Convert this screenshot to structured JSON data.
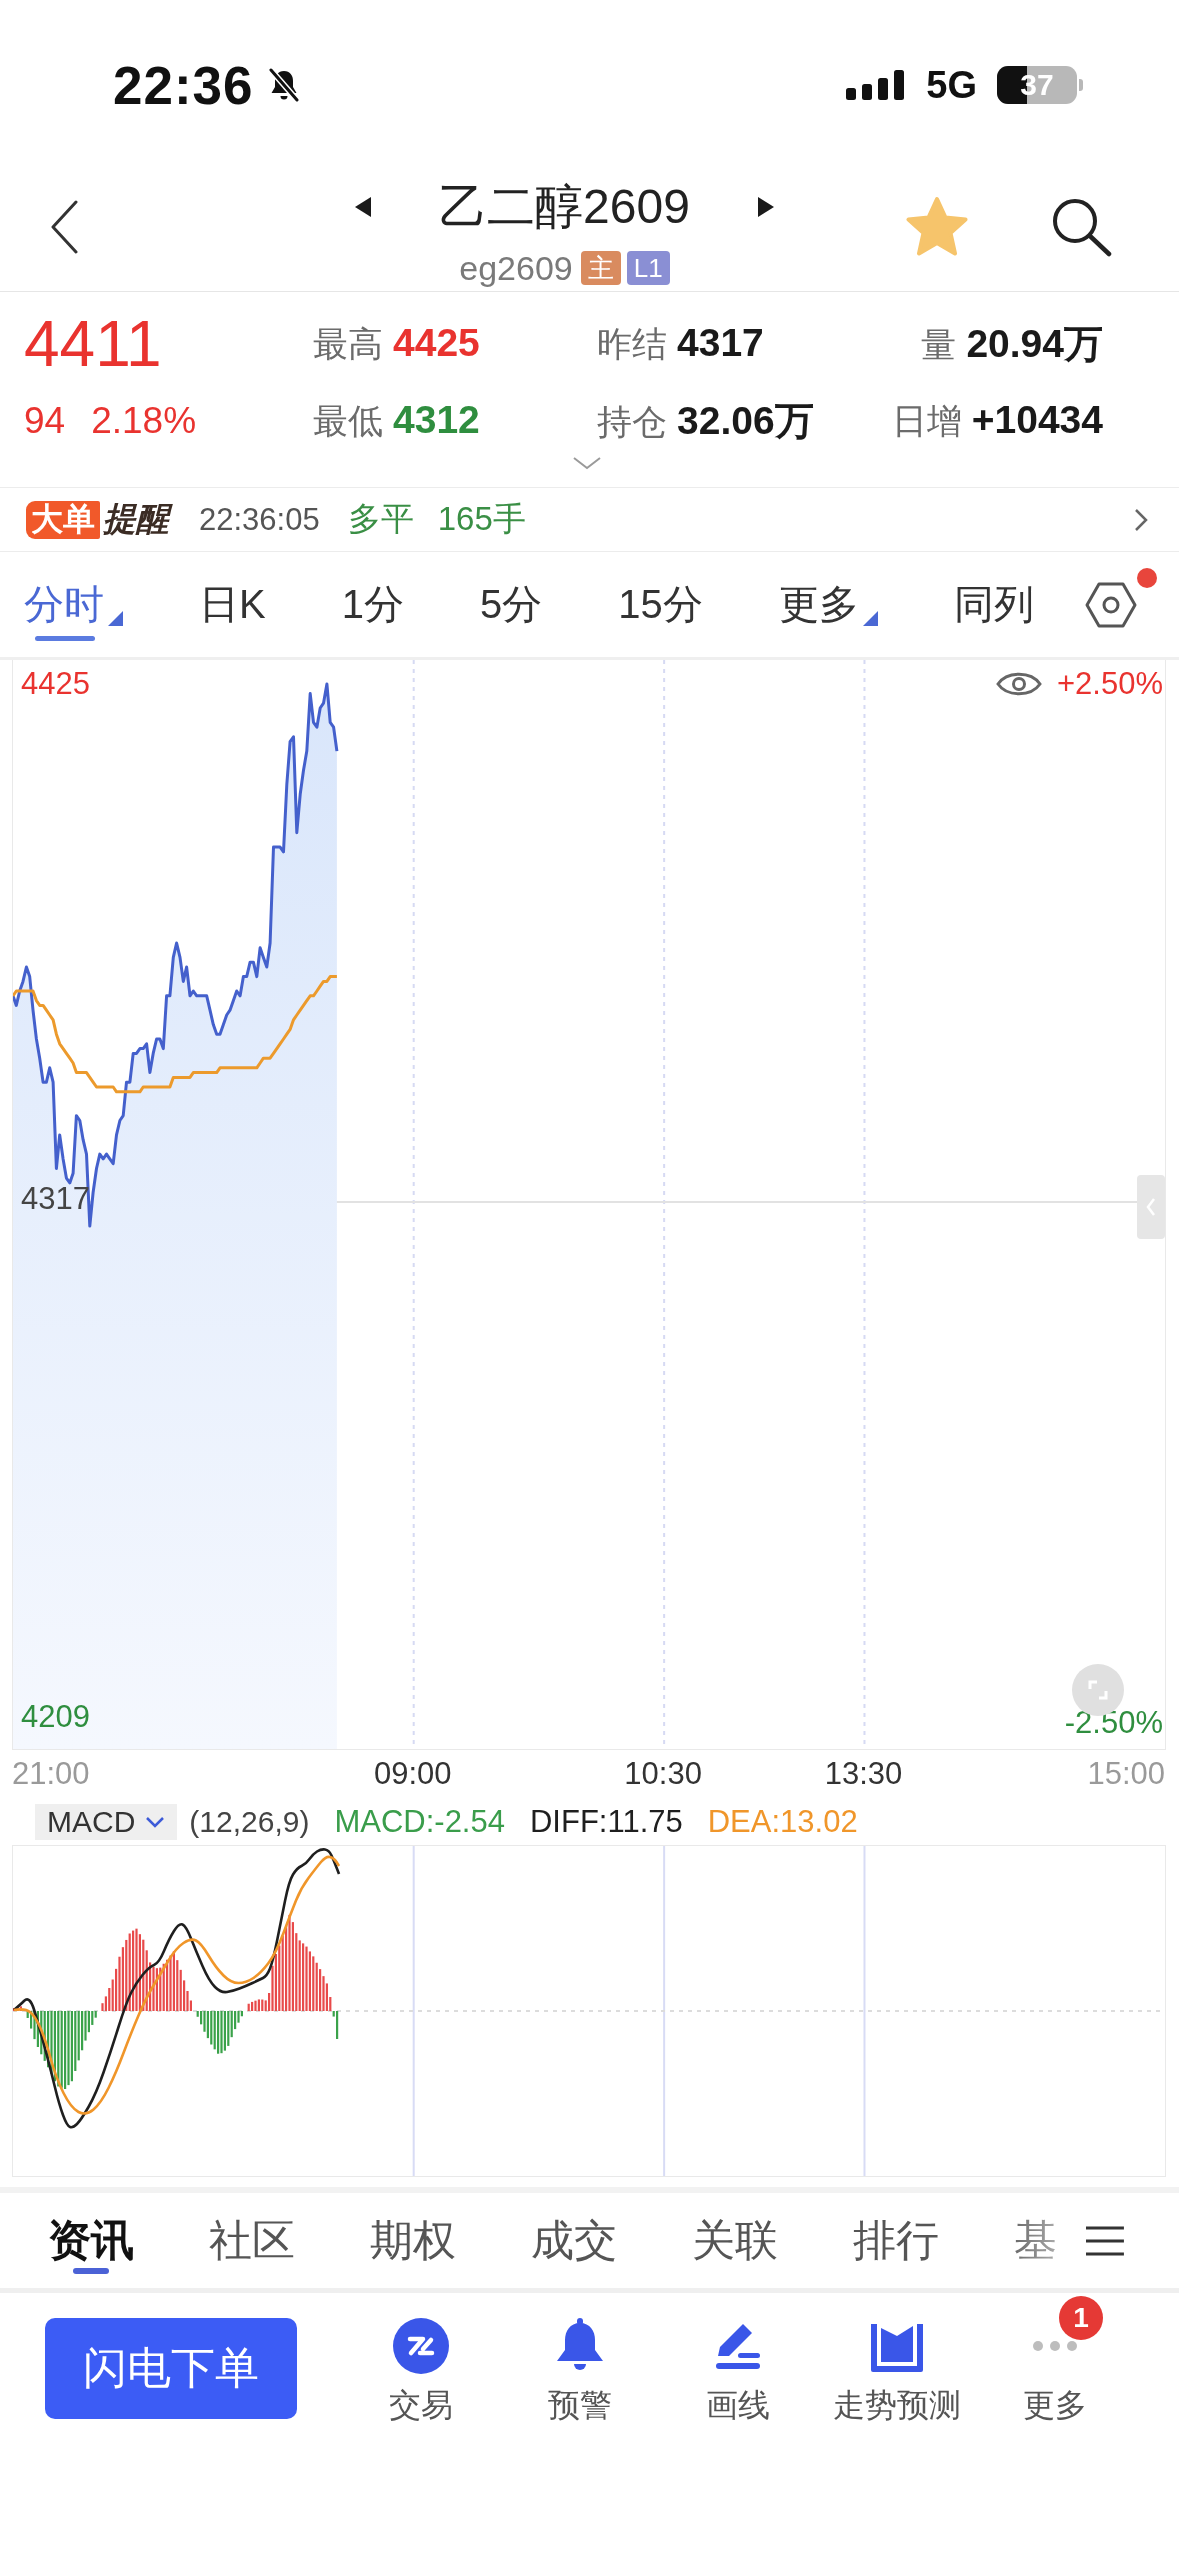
{
  "status_bar": {
    "time": "22:36",
    "silent": true,
    "network": "5G",
    "battery": "37"
  },
  "header": {
    "title": "乙二醇2609",
    "code": "eg2609",
    "badges": [
      {
        "text": "主",
        "kind": "main"
      },
      {
        "text": "L1",
        "kind": "level"
      }
    ],
    "favorite": true
  },
  "quote": {
    "price": "4411",
    "change": "94",
    "change_percent": "2.18%",
    "rising": true,
    "stats": [
      {
        "label": "最高",
        "value": "4425",
        "color": "#e9332f"
      },
      {
        "label": "昨结",
        "value": "4317",
        "color": "#1a1a1a"
      },
      {
        "label": "量",
        "value": "20.94万",
        "color": "#1a1a1a"
      },
      {
        "label": "最低",
        "value": "4312",
        "color": "#2f8e3f"
      },
      {
        "label": "持仓",
        "value": "32.06万",
        "color": "#1a1a1a"
      },
      {
        "label": "日增",
        "value": "+10434",
        "color": "#1a1a1a"
      }
    ]
  },
  "big_order_alert": {
    "badge": "大单",
    "title": "提醒",
    "time": "22:36:05",
    "action": "多平",
    "volume": "165手"
  },
  "period_bar": {
    "tabs": [
      {
        "label": "分时",
        "selected": true,
        "menu": true
      },
      {
        "label": "日K",
        "selected": false,
        "menu": false
      },
      {
        "label": "1分",
        "selected": false,
        "menu": false
      },
      {
        "label": "5分",
        "selected": false,
        "menu": false
      },
      {
        "label": "15分",
        "selected": false,
        "menu": false
      },
      {
        "label": "更多",
        "selected": false,
        "menu": true
      },
      {
        "label": "同列",
        "selected": false,
        "menu": false
      }
    ],
    "settings_dot": true
  },
  "intraday": {
    "chart_data": {
      "type": "line",
      "categories": [
        null,
        null,
        null,
        null,
        null,
        null,
        null,
        null,
        null,
        null,
        null,
        null,
        null,
        null,
        null,
        null,
        null,
        null,
        null,
        null,
        null,
        null,
        null,
        null,
        null,
        null,
        null,
        null,
        null,
        null,
        null,
        null,
        null,
        null,
        null,
        null,
        null,
        null,
        null,
        null,
        null,
        null,
        null,
        null,
        null,
        null,
        null,
        null,
        null,
        null,
        null,
        null,
        null,
        null,
        null,
        null,
        null,
        null,
        null,
        null,
        null,
        null,
        null,
        null,
        null,
        null,
        null,
        null,
        null,
        null,
        null,
        null,
        null,
        null,
        null,
        null,
        null,
        null,
        null,
        null,
        null,
        null,
        null,
        null,
        null,
        null,
        null,
        null,
        null,
        null,
        null,
        null,
        null,
        null,
        null,
        null,
        null,
        null,
        null,
        null,
        null,
        null,
        null,
        null,
        null,
        null,
        null,
        null,
        null,
        null,
        null,
        null,
        null,
        null,
        null,
        null,
        null,
        null,
        null,
        null,
        "09:00",
        null,
        null,
        null,
        null,
        null,
        null,
        null,
        null,
        null,
        null,
        null,
        null,
        null,
        null,
        null,
        null,
        null,
        null,
        null,
        null,
        null,
        null,
        null,
        null,
        null,
        null,
        null,
        null,
        null,
        null,
        null,
        null,
        null,
        null,
        null,
        null,
        null,
        null,
        null,
        null,
        null,
        null,
        null,
        null,
        null,
        null,
        null,
        null,
        null,
        null,
        null,
        null,
        null,
        null,
        null,
        null,
        null,
        null,
        null,
        null,
        null,
        null,
        null,
        null,
        null,
        null,
        null,
        null,
        null,
        null,
        null,
        null,
        null,
        null,
        "10:30",
        null,
        null,
        null,
        null,
        null,
        null,
        null,
        null,
        null,
        null,
        null,
        null,
        null,
        null,
        null,
        null,
        null,
        null,
        null,
        null,
        null,
        null,
        null,
        null,
        null,
        null,
        null,
        null,
        null,
        null,
        null,
        null,
        null,
        null,
        null,
        null,
        null,
        null,
        null,
        null,
        null,
        null,
        null,
        null,
        null,
        null,
        null,
        null,
        null,
        null,
        null,
        null,
        null,
        null,
        null,
        null,
        null,
        null,
        null,
        "13:30",
        null,
        null,
        null,
        null,
        null,
        null,
        null,
        null,
        null,
        null,
        null,
        null,
        null,
        null,
        null,
        null,
        null,
        null,
        null,
        null,
        null,
        null,
        null,
        null,
        null,
        null,
        null,
        null,
        null,
        null,
        null,
        null,
        null,
        null,
        null,
        null,
        null,
        null,
        null,
        null,
        null,
        null,
        null,
        null,
        null,
        null,
        null,
        null,
        null,
        null,
        null,
        null,
        null,
        null,
        null,
        null,
        null,
        null,
        null,
        null,
        null,
        null,
        null,
        null,
        null,
        null,
        null,
        null,
        null,
        null,
        null,
        null,
        null,
        null,
        null,
        null,
        null,
        null,
        null,
        null,
        null,
        null,
        null,
        null,
        null,
        null,
        null,
        null,
        null,
        null
      ],
      "series": [
        {
          "color": "#4460cc",
          "values": [
            4360,
            4358,
            4361,
            4363,
            4366,
            4364,
            4357,
            4351,
            4347,
            4342,
            4342,
            4345,
            4342,
            4324,
            4331,
            4326,
            4322,
            4321,
            4323,
            4335,
            4334,
            4330,
            4327,
            4312,
            4319,
            4324,
            4327,
            4326,
            4327,
            4326,
            4325,
            4331,
            4334,
            4335,
            4342,
            4342,
            4348,
            4348,
            4349,
            4349,
            4350,
            4344,
            4348,
            4351,
            4351,
            4349,
            4360,
            4360,
            4368,
            4371,
            4368,
            4363,
            4366,
            4360,
            4361,
            4360,
            4360,
            4360,
            4360,
            4357,
            4354,
            4352,
            4352,
            4354,
            4356,
            4357,
            4359,
            4361,
            4360,
            4364,
            4364,
            4367,
            4367,
            4364,
            4370,
            4368,
            4366,
            4371,
            4391,
            4391,
            4391,
            4390,
            4404,
            4413,
            4414,
            4394,
            4402,
            4407,
            4411,
            4423,
            4417,
            4416,
            4420,
            4421,
            4425,
            4417,
            4416,
            4411,
            null,
            null,
            null,
            null,
            null,
            null,
            null,
            null,
            null,
            null,
            null,
            null,
            null,
            null,
            null,
            null,
            null,
            null,
            null,
            null,
            null,
            null,
            null,
            null,
            null,
            null,
            null,
            null,
            null,
            null,
            null,
            null,
            null,
            null,
            null,
            null,
            null,
            null,
            null,
            null,
            null,
            null,
            null,
            null,
            null,
            null,
            null,
            null,
            null,
            null,
            null,
            null,
            null,
            null,
            null,
            null,
            null,
            null,
            null,
            null,
            null,
            null,
            null,
            null,
            null,
            null,
            null,
            null,
            null,
            null,
            null,
            null,
            null,
            null,
            null,
            null,
            null,
            null,
            null,
            null,
            null,
            null,
            null,
            null,
            null,
            null,
            null,
            null,
            null,
            null,
            null,
            null,
            null,
            null,
            null,
            null,
            null,
            null,
            null,
            null,
            null,
            null,
            null,
            null,
            null,
            null,
            null,
            null,
            null,
            null,
            null,
            null,
            null,
            null,
            null,
            null,
            null,
            null,
            null,
            null,
            null,
            null,
            null,
            null,
            null,
            null,
            null,
            null,
            null,
            null,
            null,
            null,
            null,
            null,
            null,
            null,
            null,
            null,
            null,
            null,
            null,
            null,
            null,
            null,
            null,
            null,
            null,
            null,
            null,
            null,
            null,
            null,
            null,
            null,
            null,
            null,
            null,
            null,
            null,
            null,
            null,
            null,
            null,
            null,
            null,
            null,
            null,
            null,
            null,
            null,
            null,
            null,
            null,
            null,
            null,
            null,
            null,
            null,
            null,
            null,
            null,
            null,
            null,
            null,
            null,
            null,
            null,
            null,
            null,
            null,
            null,
            null,
            null,
            null,
            null,
            null,
            null,
            null,
            null,
            null,
            null,
            null,
            null,
            null,
            null,
            null,
            null,
            null,
            null,
            null,
            null,
            null,
            null,
            null,
            null,
            null,
            null,
            null,
            null,
            null,
            null,
            null,
            null,
            null,
            null,
            null,
            null,
            null,
            null,
            null,
            null,
            null,
            null,
            null,
            null,
            null,
            null,
            null,
            null,
            null,
            null,
            null,
            null,
            null,
            null,
            null,
            null,
            null
          ]
        },
        {
          "color": "#ec9a2c",
          "values": [
            4360,
            4361,
            4361,
            4361,
            4361,
            4361,
            4361,
            4359,
            4358,
            4358,
            4357,
            4356,
            4355,
            4352,
            4350,
            4349,
            4348,
            4347,
            4346,
            4344,
            4344,
            4344,
            4344,
            4343,
            4342,
            4341,
            4341,
            4341,
            4341,
            4341,
            4341,
            4340,
            4340,
            4340,
            4340,
            4340,
            4340,
            4340,
            4340,
            4341,
            4341,
            4341,
            4341,
            4341,
            4341,
            4341,
            4341,
            4341,
            4343,
            4343,
            4343,
            4343,
            4343,
            4343,
            4344,
            4344,
            4344,
            4344,
            4344,
            4344,
            4344,
            4344,
            4345,
            4345,
            4345,
            4345,
            4345,
            4345,
            4345,
            4345,
            4345,
            4345,
            4345,
            4345,
            4346,
            4347,
            4347,
            4347,
            4348,
            4349,
            4350,
            4351,
            4352,
            4353,
            4355,
            4356,
            4357,
            4358,
            4359,
            4360,
            4360,
            4361,
            4362,
            4363,
            4363,
            4364,
            4364,
            4364,
            null,
            null,
            null,
            null,
            null,
            null,
            null,
            null,
            null,
            null,
            null,
            null,
            null,
            null,
            null,
            null,
            null,
            null,
            null,
            null,
            null,
            null,
            null,
            null,
            null,
            null,
            null,
            null,
            null,
            null,
            null,
            null,
            null,
            null,
            null,
            null,
            null,
            null,
            null,
            null,
            null,
            null,
            null,
            null,
            null,
            null,
            null,
            null,
            null,
            null,
            null,
            null,
            null,
            null,
            null,
            null,
            null,
            null,
            null,
            null,
            null,
            null,
            null,
            null,
            null,
            null,
            null,
            null,
            null,
            null,
            null,
            null,
            null,
            null,
            null,
            null,
            null,
            null,
            null,
            null,
            null,
            null,
            null,
            null,
            null,
            null,
            null,
            null,
            null,
            null,
            null,
            null,
            null,
            null,
            null,
            null,
            null,
            null,
            null,
            null,
            null,
            null,
            null,
            null,
            null,
            null,
            null,
            null,
            null,
            null,
            null,
            null,
            null,
            null,
            null,
            null,
            null,
            null,
            null,
            null,
            null,
            null,
            null,
            null,
            null,
            null,
            null,
            null,
            null,
            null,
            null,
            null,
            null,
            null,
            null,
            null,
            null,
            null,
            null,
            null,
            null,
            null,
            null,
            null,
            null,
            null,
            null,
            null,
            null,
            null,
            null,
            null,
            null,
            null,
            null,
            null,
            null,
            null,
            null,
            null,
            null,
            null,
            null,
            null,
            null,
            null,
            null,
            null,
            null,
            null,
            null,
            null,
            null,
            null,
            null,
            null,
            null,
            null,
            null,
            null,
            null,
            null,
            null,
            null,
            null,
            null,
            null,
            null,
            null,
            null,
            null,
            null,
            null,
            null,
            null,
            null,
            null,
            null,
            null,
            null,
            null,
            null,
            null,
            null,
            null,
            null,
            null,
            null,
            null,
            null,
            null,
            null,
            null,
            null,
            null,
            null,
            null,
            null,
            null,
            null,
            null,
            null,
            null,
            null,
            null,
            null,
            null,
            null,
            null,
            null,
            null,
            null,
            null,
            null,
            null,
            null,
            null,
            null,
            null,
            null,
            null,
            null,
            null,
            null,
            null,
            null,
            null,
            null
          ]
        }
      ],
      "ylim": [
        4203,
        4430
      ],
      "yticks": [
        4425,
        4317,
        4209
      ],
      "ref_lines": [
        {
          "axis": "y",
          "value": 4317
        }
      ]
    },
    "axis_end_labels": [
      "21:00",
      "15:00"
    ],
    "percent_labels": [
      "+2.50%",
      "-2.50%"
    ]
  },
  "macd": {
    "indicator": "MACD",
    "params": "(12,26,9)",
    "readings": [
      {
        "text": "MACD:-2.54",
        "color": "#3a9d4b"
      },
      {
        "text": "DIFF:11.75",
        "color": "#1f1f1f"
      },
      {
        "text": "DEA:13.02",
        "color": "#f0962a"
      }
    ]
  },
  "info_tabs": [
    {
      "label": "资讯",
      "selected": true
    },
    {
      "label": "社区",
      "selected": false
    },
    {
      "label": "期权",
      "selected": false
    },
    {
      "label": "成交",
      "selected": false
    },
    {
      "label": "关联",
      "selected": false
    },
    {
      "label": "排行",
      "selected": false
    },
    {
      "label": "基",
      "selected": false
    }
  ],
  "bottom_bar": {
    "order_button": "闪电下单",
    "tools": [
      {
        "kind": "trade",
        "label": "交易"
      },
      {
        "kind": "alert",
        "label": "预警"
      },
      {
        "kind": "draw",
        "label": "画线"
      },
      {
        "kind": "forecast",
        "label": "走势预测"
      },
      {
        "kind": "more",
        "label": "更多",
        "badge": "1"
      }
    ]
  }
}
